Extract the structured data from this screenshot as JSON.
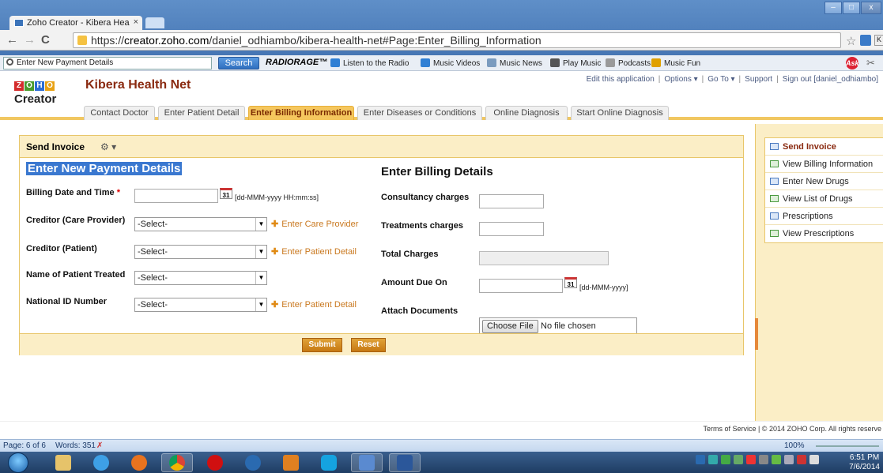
{
  "browser": {
    "tab_title": "Zoho Creator - Kibera Hea",
    "tab_close": "×",
    "url_prefix": "https://",
    "url_domain": "creator.zoho.com",
    "url_path": "/daniel_odhiambo/kibera-health-net#Page:Enter_Billing_Information"
  },
  "toolbar": {
    "search_value": "Enter New Payment Details",
    "search_button": "Search",
    "brand": "RADIORAGE™",
    "items": [
      "Listen to the Radio",
      "Music Videos",
      "Music News",
      "Play Music",
      "Podcasts",
      "Music Fun"
    ],
    "colors": [
      "#2f7fd4",
      "#2f7fd4",
      "#7a9bbf",
      "#555555",
      "#9a9a9a",
      "#e0a000"
    ]
  },
  "app": {
    "logo_text": "ZOHO",
    "logo_colors": [
      "#d42b2b",
      "#4a9b2c",
      "#2b6cd4",
      "#e8a215"
    ],
    "logo_sub": "Creator",
    "title": "Kibera Health Net",
    "links": {
      "edit": "Edit this application",
      "options": "Options ▾",
      "goto": "Go To ▾",
      "support": "Support",
      "signout": "Sign out [daniel_odhiambo]"
    },
    "tabs": [
      "Contact Doctor",
      "Enter Patient Detail",
      "Enter Billing Information",
      "Enter Diseases or Conditions",
      "Online Diagnosis",
      "Start Online Diagnosis"
    ],
    "active_tab": "Enter Billing Information"
  },
  "form": {
    "title": "Send Invoice",
    "left_section": "Enter New Payment Details",
    "right_section": "Enter Billing Details",
    "billing_date_label": "Billing Date and Time",
    "required_mark": "*",
    "date_time_hint": "[dd-MMM-yyyy HH:mm:ss]",
    "calendar_text": "31",
    "creditor_care_label": "Creditor (Care Provider)",
    "creditor_patient_label": "Creditor (Patient)",
    "patient_treated_label": "Name of Patient Treated",
    "national_id_label": "National ID Number",
    "select_placeholder": "-Select-",
    "add_care_provider": "Enter Care Provider",
    "add_patient_detail": "Enter Patient Detail",
    "consultancy_label": "Consultancy charges",
    "treatments_label": "Treatments charges",
    "total_label": "Total Charges",
    "amount_due_label": "Amount Due On",
    "date_hint": "[dd-MMM-yyyy]",
    "attach_label": "Attach Documents",
    "choose_file": "Choose File",
    "no_file": "No file chosen",
    "submit": "Submit",
    "reset": "Reset"
  },
  "sidebar": {
    "items": [
      {
        "label": "Send Invoice",
        "icon": "form-icon"
      },
      {
        "label": "View Billing Information",
        "icon": "view-icon"
      },
      {
        "label": "Enter New Drugs",
        "icon": "form-icon"
      },
      {
        "label": "View List of Drugs",
        "icon": "view-icon"
      },
      {
        "label": "Prescriptions",
        "icon": "form-icon"
      },
      {
        "label": "View Prescriptions",
        "icon": "view-icon"
      }
    ]
  },
  "footer": {
    "text": "Terms of Service | © 2014 ZOHO Corp. All rights reserve"
  },
  "word": {
    "page": "Page: 6 of 6",
    "words": "Words: 351",
    "zoom": "100%"
  },
  "taskbar": {
    "time": "6:51 PM",
    "date": "7/6/2014"
  }
}
